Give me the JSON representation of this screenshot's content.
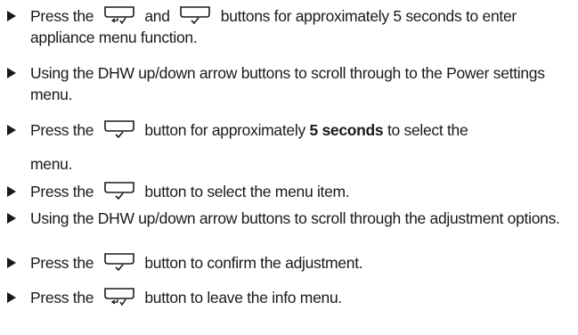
{
  "steps": [
    {
      "pre": "Press the",
      "mid": "and",
      "post": "buttons for approximately 5 seconds to enter appliance menu function.",
      "icon1": "back-button-icon",
      "icon2": "ok-check-button-icon"
    },
    {
      "text": "Using the DHW up/down arrow buttons to scroll through to the Power settings menu."
    },
    {
      "pre": "Press the",
      "post_a": "button for approximately",
      "bold": "5 seconds",
      "post_b": "to select the",
      "cont": "menu.",
      "icon": "ok-check-button-icon"
    },
    {
      "pre": "Press the",
      "post": "button to select the menu item.",
      "icon": "ok-check-button-icon"
    },
    {
      "text": "Using the DHW up/down arrow buttons to scroll through the adjustment options."
    },
    {
      "pre": "Press the",
      "post": "button to confirm the adjustment.",
      "icon": "ok-check-button-icon"
    },
    {
      "pre": "Press the",
      "post": "button to leave the info menu.",
      "icon": "back-button-icon"
    }
  ]
}
